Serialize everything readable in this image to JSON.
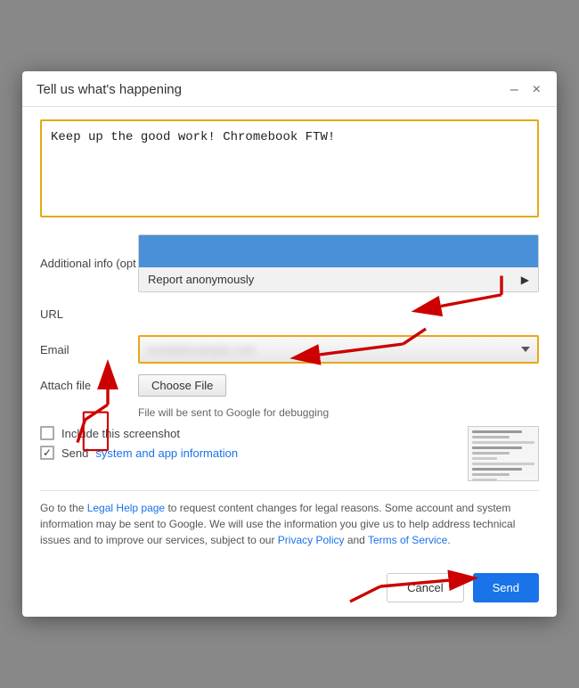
{
  "dialog": {
    "title": "Tell us what's happening",
    "minimize_label": "–",
    "close_label": "×"
  },
  "feedback_text": "Keep up the good work! Chromebook FTW!",
  "form": {
    "additional_info_label": "Additional info (opt",
    "url_label": "URL",
    "email_label": "Email",
    "email_placeholder": "email@example.com",
    "attach_label": "Attach file",
    "choose_file_label": "Choose File",
    "file_hint": "File will be sent to Google for debugging",
    "anonymous_option": "Report anonymously",
    "include_screenshot_label": "Include this screenshot",
    "send_info_label": "Send ",
    "send_info_link": "system and app information"
  },
  "legal": {
    "text_before_link": "Go to the ",
    "legal_help_text": "Legal Help page",
    "text_after_legal": " to request content changes for legal reasons. Some account and system information may be sent to Google. We will use the information you give us to help address technical issues and to improve our services, subject to our ",
    "privacy_text": "Privacy Policy",
    "text_between": " and ",
    "terms_text": "Terms of Service",
    "text_end": "."
  },
  "footer": {
    "cancel_label": "Cancel",
    "send_label": "Send"
  }
}
